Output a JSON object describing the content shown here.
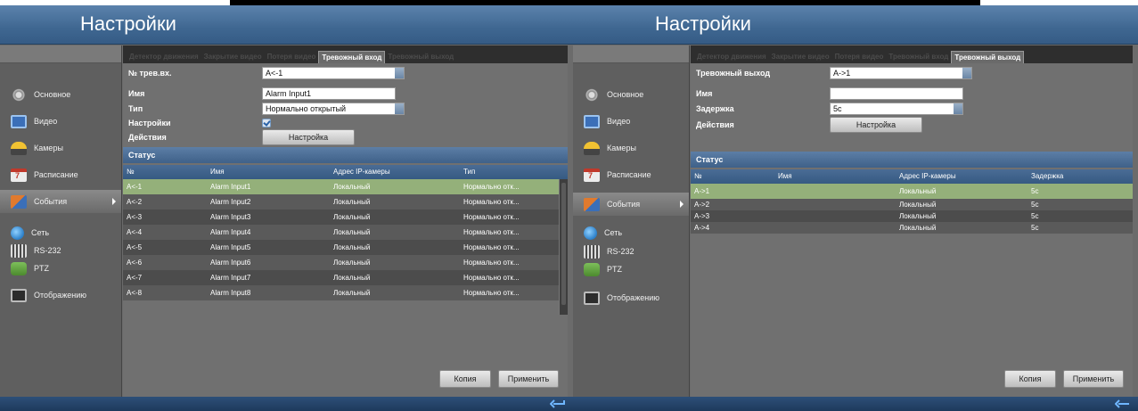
{
  "left": {
    "title": "Настройки",
    "sidebar": [
      {
        "label": "Основное",
        "icon": "gear-icon"
      },
      {
        "label": "Видео",
        "icon": "video-icon"
      },
      {
        "label": "Камеры",
        "icon": "camera-icon"
      },
      {
        "label": "Расписание",
        "icon": "calendar-icon"
      },
      {
        "label": "События",
        "icon": "events-flag-icon",
        "active": true
      },
      {
        "label": "Сеть",
        "icon": "network-globe-icon"
      },
      {
        "label": "RS-232",
        "icon": "rs232-icon"
      },
      {
        "label": "PTZ",
        "icon": "ptz-icon"
      },
      {
        "label": "Отображению",
        "icon": "display-icon"
      }
    ],
    "tabs": [
      "Детектор движения",
      "Закрытие видео",
      "Потеря видео",
      "Тревожный вход",
      "Тревожный выход"
    ],
    "active_tab": 3,
    "form": {
      "input_no_label": "№ трев.вх.",
      "input_no_value": "A<-1",
      "name_label": "Имя",
      "name_value": "Alarm Input1",
      "type_label": "Тип",
      "type_value": "Нормально открытый",
      "settings_label": "Настройки",
      "settings_checked": true,
      "action_label": "Действия",
      "action_button": "Настройка"
    },
    "status_label": "Статус",
    "table": {
      "headers": [
        "№",
        "Имя",
        "Адрес IP-камеры",
        "Тип"
      ],
      "rows": [
        [
          "A<-1",
          "Alarm Input1",
          "Локальный",
          "Нормально отк..."
        ],
        [
          "A<-2",
          "Alarm Input2",
          "Локальный",
          "Нормально отк..."
        ],
        [
          "A<-3",
          "Alarm Input3",
          "Локальный",
          "Нормально отк..."
        ],
        [
          "A<-4",
          "Alarm Input4",
          "Локальный",
          "Нормально отк..."
        ],
        [
          "A<-5",
          "Alarm Input5",
          "Локальный",
          "Нормально отк..."
        ],
        [
          "A<-6",
          "Alarm Input6",
          "Локальный",
          "Нормально отк..."
        ],
        [
          "A<-7",
          "Alarm Input7",
          "Локальный",
          "Нормально отк..."
        ],
        [
          "A<-8",
          "Alarm Input8",
          "Локальный",
          "Нормально отк..."
        ]
      ],
      "selected_row": 0
    },
    "buttons": {
      "copy": "Копия",
      "apply": "Применить"
    }
  },
  "right": {
    "title": "Настройки",
    "sidebar": [
      {
        "label": "Основное",
        "icon": "gear-icon"
      },
      {
        "label": "Видео",
        "icon": "video-icon"
      },
      {
        "label": "Камеры",
        "icon": "camera-icon"
      },
      {
        "label": "Расписание",
        "icon": "calendar-icon"
      },
      {
        "label": "События",
        "icon": "events-flag-icon",
        "active": true
      },
      {
        "label": "Сеть",
        "icon": "network-globe-icon"
      },
      {
        "label": "RS-232",
        "icon": "rs232-icon"
      },
      {
        "label": "PTZ",
        "icon": "ptz-icon"
      },
      {
        "label": "Отображению",
        "icon": "display-icon"
      }
    ],
    "tabs": [
      "Детектор движения",
      "Закрытие видео",
      "Потеря видео",
      "Тревожный вход",
      "Тревожный выход"
    ],
    "active_tab": 4,
    "form": {
      "output_label": "Тревожный выход",
      "output_value": "A->1",
      "name_label": "Имя",
      "name_value": "",
      "delay_label": "Задержка",
      "delay_value": "5с",
      "action_label": "Действия",
      "action_button": "Настройка"
    },
    "status_label": "Статус",
    "table": {
      "headers": [
        "№",
        "Имя",
        "Адрес IP-камеры",
        "Задержка"
      ],
      "rows": [
        [
          "A->1",
          "",
          "Локальный",
          "5с"
        ],
        [
          "A->2",
          "",
          "Локальный",
          "5с"
        ],
        [
          "A->3",
          "",
          "Локальный",
          "5с"
        ],
        [
          "A->4",
          "",
          "Локальный",
          "5с"
        ]
      ],
      "selected_row": 0
    },
    "buttons": {
      "copy": "Копия",
      "apply": "Применить"
    }
  },
  "colors": {
    "header": "#3f6791",
    "panel": "#6b6b6b",
    "selected_row": "#94b07a",
    "status_bar": "#4a6c95"
  }
}
